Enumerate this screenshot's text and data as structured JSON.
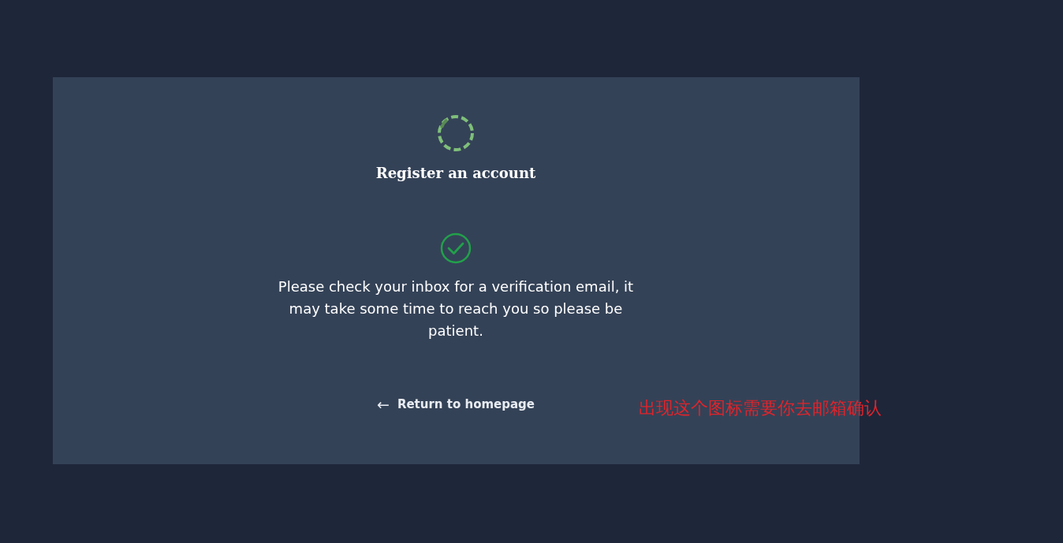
{
  "card": {
    "title": "Register an account",
    "message": "Please check your inbox for a verification email, it may take some time to reach you so please be patient.",
    "link": {
      "arrow": "←",
      "label": "Return to homepage"
    }
  },
  "annotation": {
    "text": "出现这个图标需要你去邮箱确认",
    "color": "#e0242b"
  }
}
